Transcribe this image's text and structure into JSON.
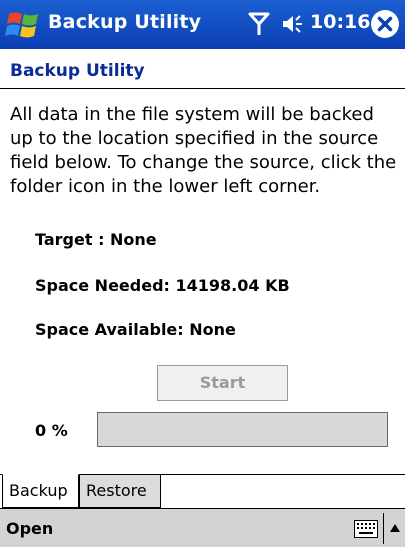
{
  "titlebar": {
    "app_title": "Backup Utility",
    "time": "10:16",
    "icons": {
      "start": "windows-logo-icon",
      "signal": "signal-icon",
      "volume": "volume-icon",
      "close": "close-icon"
    },
    "colors": {
      "background": "#1a5fd0",
      "text": "#ffffff"
    }
  },
  "page": {
    "title": "Backup Utility",
    "description": "All data in the file system will be backed up to the location specified in the source field below. To change the source, click the folder icon in the lower left corner."
  },
  "info": {
    "target": "Target : None",
    "space_needed": "Space Needed: 14198.04 KB",
    "space_available": "Space Available: None"
  },
  "start_button": {
    "label": "Start",
    "enabled": false
  },
  "progress": {
    "label": "0 %",
    "value": 0
  },
  "tabs": [
    {
      "label": "Backup",
      "active": true
    },
    {
      "label": "Restore",
      "active": false
    }
  ],
  "command_bar": {
    "menu_label": "Open",
    "icons": {
      "keyboard": "keyboard-icon",
      "sip_toggle": "arrow-up-icon"
    }
  }
}
